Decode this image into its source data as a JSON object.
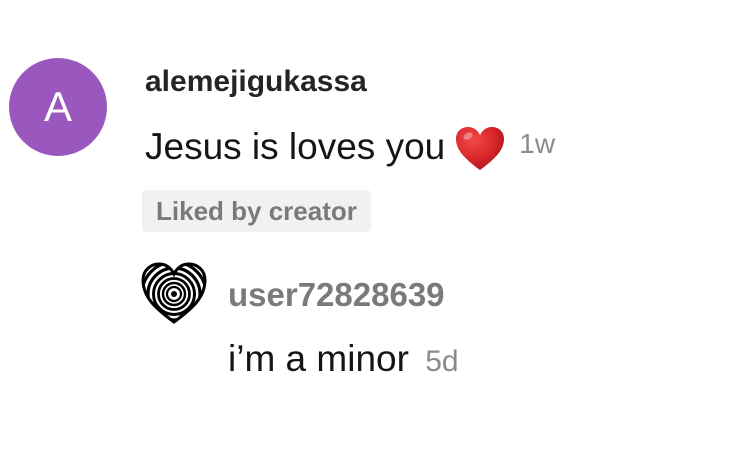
{
  "comments": [
    {
      "avatar_letter": "A",
      "avatar_color": "#9a58bf",
      "username": "alemejigukassa",
      "text": "Jesus is loves you",
      "emoji": "red-heart-icon",
      "time": "1w",
      "badge": "Liked by creator"
    },
    {
      "avatar": "heart-spiral-avatar-icon",
      "username": "user72828639",
      "text": "i’m a minor",
      "time": "5d"
    }
  ],
  "colors": {
    "secondary_text": "#8b8b8b",
    "badge_bg": "#f1f1f1",
    "heart": "#d8262b"
  }
}
